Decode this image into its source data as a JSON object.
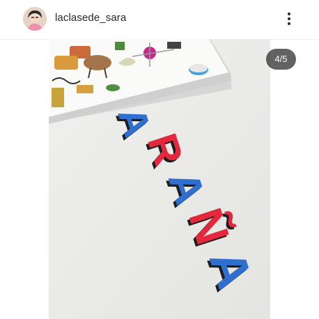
{
  "post": {
    "username": "laclasede_sara",
    "counter": "4/5",
    "photo": {
      "letters": [
        "A",
        "R",
        "A",
        "Ñ",
        "A"
      ],
      "letter_colors": {
        "blue": "#2f6fd0",
        "red": "#e3283e"
      }
    }
  },
  "icons": {
    "avatar": "profile-avatar",
    "more": "more-options-icon"
  }
}
